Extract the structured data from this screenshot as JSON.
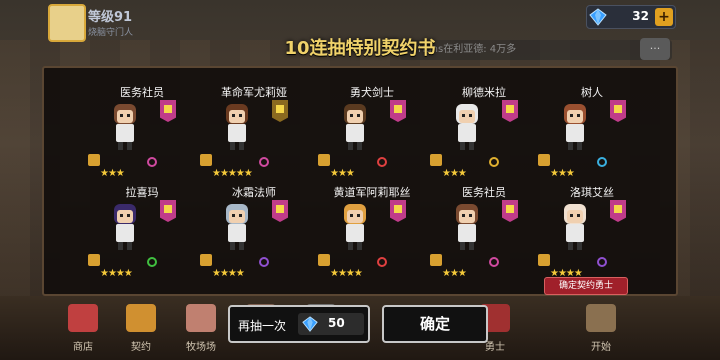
{
  "header": {
    "level": "等级91",
    "player_name": "烧脑守门人",
    "gems": "32"
  },
  "chat": {
    "text": "Hans在利亚德: 4万多"
  },
  "dialog": {
    "title": "10连抽特别契约书"
  },
  "cards": [
    {
      "name": "医务社员",
      "stars": "★★★",
      "hair": "#7a4a30",
      "badge": "#c03c8a",
      "weapon": "#d04aa0"
    },
    {
      "name": "革命军尤莉娅",
      "stars": "★★★★★",
      "hair": "#6a3a20",
      "badge": "#8a6a20",
      "weapon": "#d04aa0"
    },
    {
      "name": "勇犬剑士",
      "stars": "★★★",
      "hair": "#5a3a20",
      "badge": "#c03c8a",
      "weapon": "#e04040"
    },
    {
      "name": "柳德米拉",
      "stars": "★★★",
      "hair": "#e8e8e8",
      "badge": "#c03c8a",
      "weapon": "#e0b030"
    },
    {
      "name": "树人",
      "stars": "★★★",
      "hair": "#9a5030",
      "badge": "#c03c8a",
      "weapon": "#3ab0e0"
    },
    {
      "name": "拉喜玛",
      "stars": "★★★★",
      "hair": "#3a2a6a",
      "badge": "#c03c8a",
      "weapon": "#40c040"
    },
    {
      "name": "冰霜法师",
      "stars": "★★★★",
      "hair": "#a8b8c8",
      "badge": "#c03c8a",
      "weapon": "#9050d0"
    },
    {
      "name": "黄道军阿莉耶丝",
      "stars": "★★★★",
      "hair": "#e0a040",
      "badge": "#c03c8a",
      "weapon": "#e04040"
    },
    {
      "name": "医务社员",
      "stars": "★★★",
      "hair": "#7a4a30",
      "badge": "#c03c8a",
      "weapon": "#d04aa0"
    },
    {
      "name": "洛琪艾丝",
      "stars": "★★★★",
      "hair": "#f0e0d0",
      "badge": "#c03c8a",
      "weapon": "#9050d0"
    }
  ],
  "confirm_banner": "确定契约勇士",
  "nav": [
    {
      "label": "商店",
      "icon": "shop-icon",
      "color": "#c04040"
    },
    {
      "label": "契约",
      "icon": "contract-icon",
      "color": "#d09030"
    },
    {
      "label": "牧场场",
      "icon": "ranch-icon",
      "color": "#c08070"
    },
    {
      "label": "",
      "icon": "quest-icon",
      "color": "#806050"
    },
    {
      "label": "",
      "icon": "shield-icon",
      "color": "#707070"
    },
    {
      "label": "勇士",
      "icon": "hero-icon",
      "color": "#a03030"
    },
    {
      "label": "开始",
      "icon": "start-icon",
      "color": "#8a7050"
    }
  ],
  "actions": {
    "reroll_label": "再抽一次",
    "reroll_cost": "50",
    "confirm_label": "确定"
  },
  "colors": {
    "accent_gold": "#f0d26a",
    "star": "#f4c93a",
    "gem": "#3aa0ff"
  }
}
